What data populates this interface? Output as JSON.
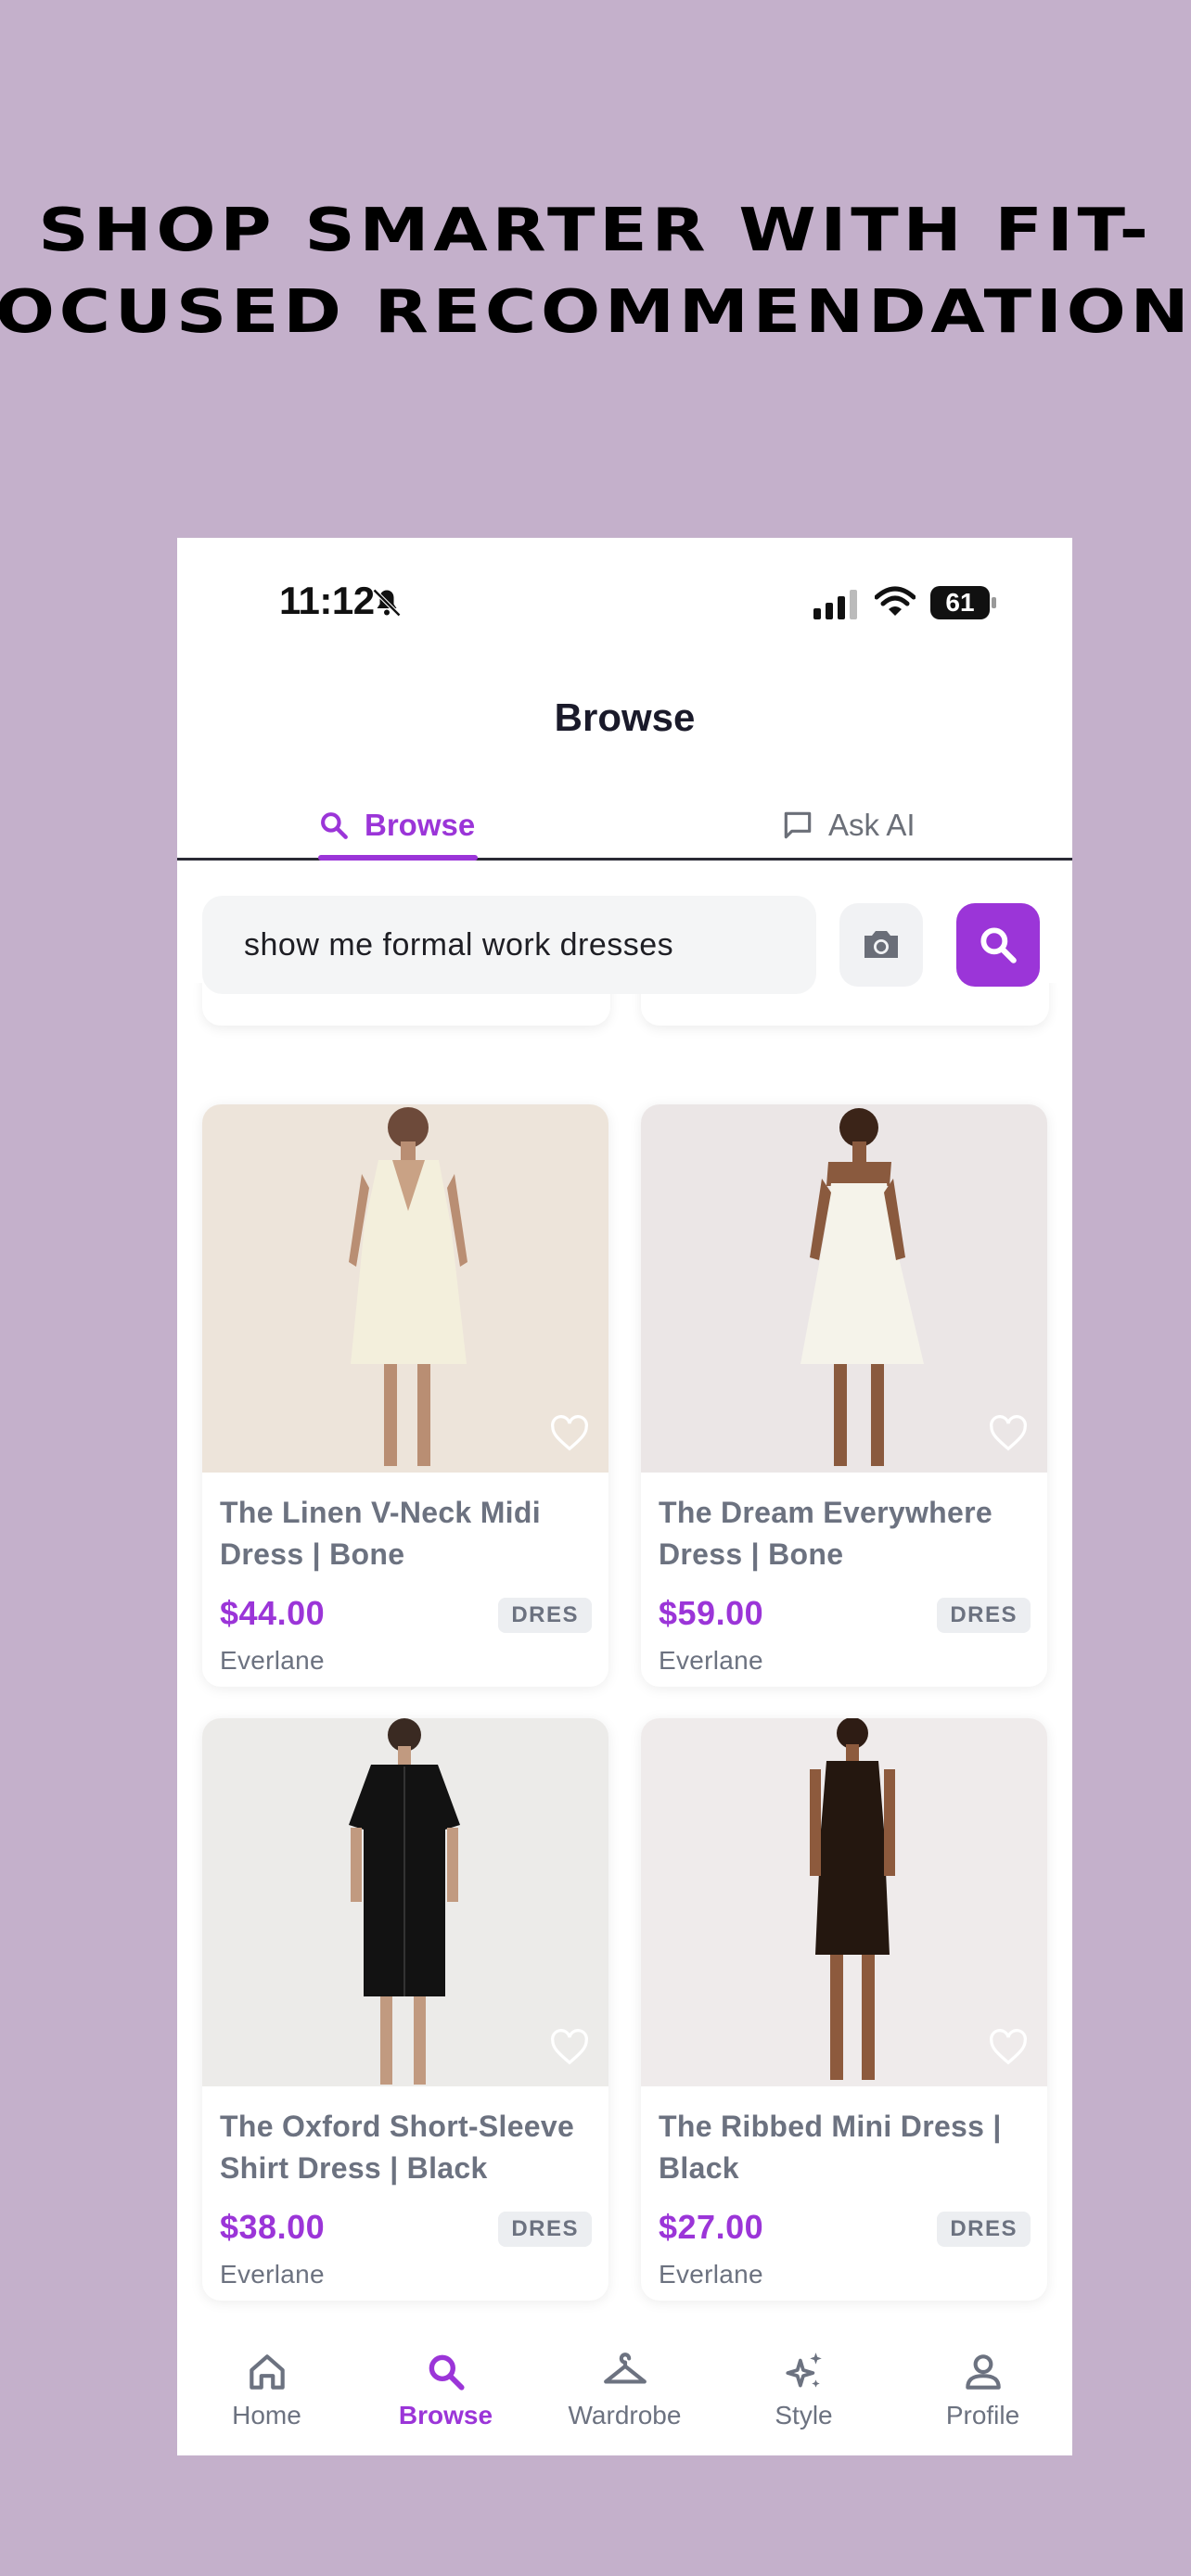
{
  "headline": "SHOP SMARTER WITH FIT-FOCUSED RECOMMENDATIONS",
  "status_bar": {
    "time": "11:12",
    "battery": "61"
  },
  "page_title": "Browse",
  "tabs": [
    {
      "label": "Browse",
      "icon": "search-icon",
      "active": true
    },
    {
      "label": "Ask AI",
      "icon": "chat-icon",
      "active": false
    }
  ],
  "search": {
    "value": "show me formal work dresses"
  },
  "products": [
    {
      "title": "The Linen V-Neck Midi Dress | Bone",
      "price": "$44.00",
      "tag": "DRES",
      "brand": "Everlane",
      "dress_color": "#f3efdc"
    },
    {
      "title": "The Dream Everywhere Dress | Bone",
      "price": "$59.00",
      "tag": "DRES",
      "brand": "Everlane",
      "dress_color": "#f5f3ea"
    },
    {
      "title": "The Oxford Short-Sleeve Shirt Dress | Black",
      "price": "$38.00",
      "tag": "DRES",
      "brand": "Everlane",
      "dress_color": "#121212"
    },
    {
      "title": "The Ribbed Mini Dress | Black",
      "price": "$27.00",
      "tag": "DRES",
      "brand": "Everlane",
      "dress_color": "#24170f"
    }
  ],
  "bottom_nav": [
    {
      "label": "Home",
      "icon": "home-icon",
      "active": false
    },
    {
      "label": "Browse",
      "icon": "search-icon",
      "active": true
    },
    {
      "label": "Wardrobe",
      "icon": "hanger-icon",
      "active": false
    },
    {
      "label": "Style",
      "icon": "sparkle-icon",
      "active": false
    },
    {
      "label": "Profile",
      "icon": "profile-icon",
      "active": false
    }
  ],
  "colors": {
    "accent": "#9b35d8",
    "background": "#c4b0cb",
    "muted_text": "#6c7280"
  }
}
